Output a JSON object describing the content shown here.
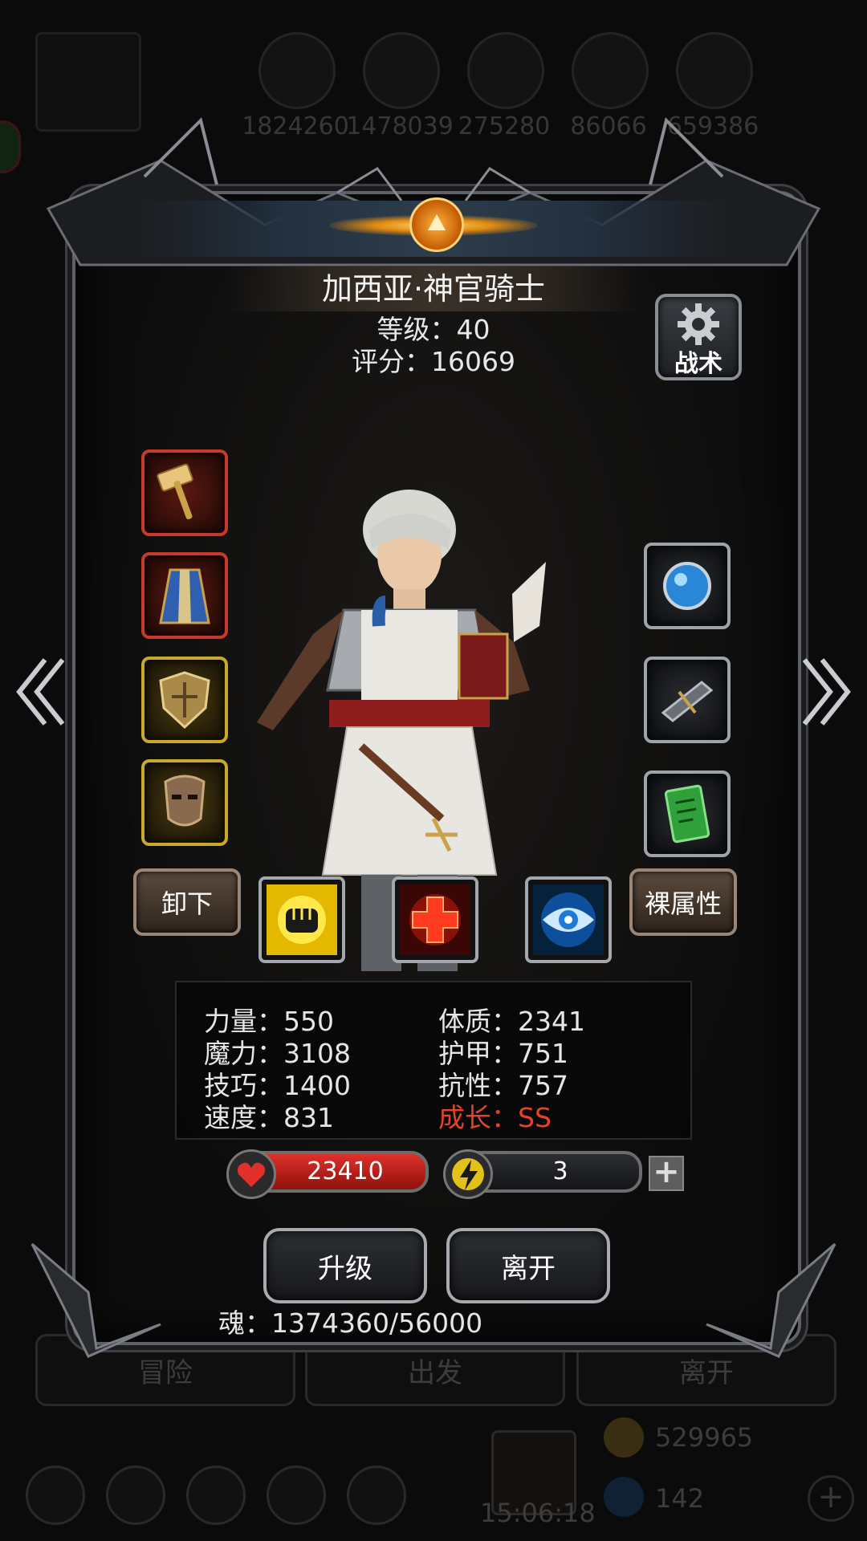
{
  "background": {
    "resource_values": [
      "1824260",
      "1478039",
      "275280",
      "86066",
      "659386"
    ],
    "tabs": [
      "冒险",
      "出发",
      "离开"
    ],
    "gold": "529965",
    "clock": "15:06:18",
    "gems": "142"
  },
  "character": {
    "name": "加西亚·神官骑士",
    "level": "等级：40",
    "score": "评分：16069"
  },
  "tactics": {
    "label": "战术"
  },
  "equipment_left": [
    "hammer-icon",
    "robe-icon",
    "shield-icon",
    "mask-icon"
  ],
  "equipment_right": [
    "blue-orb-icon",
    "crossbow-icon",
    "green-card-icon"
  ],
  "actions": {
    "unequip": "卸下",
    "base_stats": "裸属性",
    "skills": [
      "fist-icon",
      "red-cross-icon",
      "eye-icon"
    ]
  },
  "stats": {
    "strength": "力量：550",
    "magic": "魔力：3108",
    "skill": "技巧：1400",
    "speed": "速度：831",
    "constitution": "体质：2341",
    "armor": "护甲：751",
    "resistance": "抗性：757",
    "growth": "成长：SS"
  },
  "hp": "23410",
  "energy": "3",
  "buttons": {
    "upgrade": "升级",
    "leave": "离开"
  },
  "soul": "魂：1374360/56000",
  "colors": {
    "hp": "#e0302a",
    "growth": "#e2432a",
    "accent_gold": "#ffb340"
  }
}
